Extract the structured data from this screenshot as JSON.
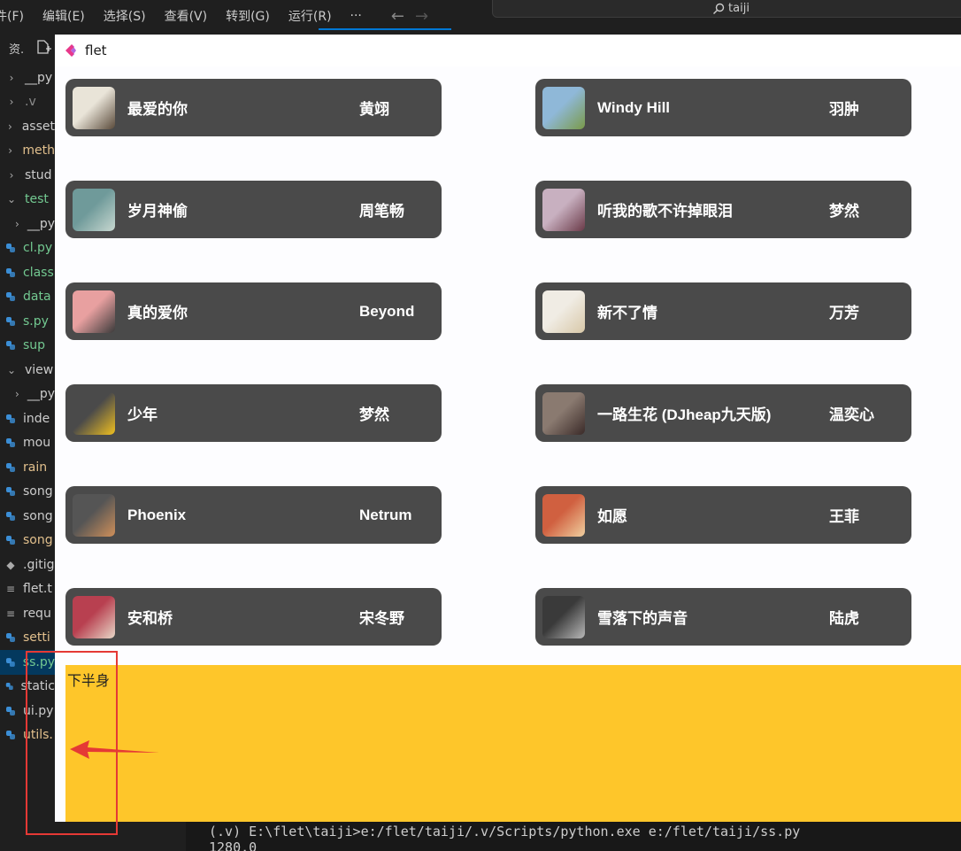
{
  "menubar": {
    "items": [
      "件(F)",
      "编辑(E)",
      "选择(S)",
      "查看(V)",
      "转到(G)",
      "运行(R)",
      "···"
    ],
    "search_text": "taiji"
  },
  "explorer": {
    "title": "资.",
    "rows": [
      {
        "label": "__py",
        "kind": "folder",
        "color": "c-gray",
        "expanded": false,
        "indent": false
      },
      {
        "label": ".v",
        "kind": "folder",
        "color": "c-dim",
        "expanded": false,
        "indent": false
      },
      {
        "label": "asset",
        "kind": "folder",
        "color": "c-gray",
        "expanded": false,
        "indent": false
      },
      {
        "label": "meth",
        "kind": "folder",
        "color": "c-yellow",
        "expanded": false,
        "indent": false
      },
      {
        "label": "stud",
        "kind": "folder",
        "color": "c-gray",
        "expanded": false,
        "indent": false
      },
      {
        "label": "test",
        "kind": "folder",
        "color": "c-green",
        "expanded": true,
        "indent": false
      },
      {
        "label": "__py",
        "kind": "folder",
        "color": "c-gray",
        "expanded": false,
        "indent": true
      },
      {
        "label": "cl.py",
        "kind": "py",
        "color": "c-green",
        "indent": false
      },
      {
        "label": "class",
        "kind": "py",
        "color": "c-green",
        "indent": false
      },
      {
        "label": "data",
        "kind": "py",
        "color": "c-green",
        "indent": false
      },
      {
        "label": "s.py",
        "kind": "py",
        "color": "c-green",
        "indent": false
      },
      {
        "label": "sup",
        "kind": "py",
        "color": "c-green",
        "indent": false
      },
      {
        "label": "view",
        "kind": "folder",
        "color": "c-gray",
        "expanded": true,
        "indent": false
      },
      {
        "label": "__py",
        "kind": "folder",
        "color": "c-gray",
        "expanded": false,
        "indent": true
      },
      {
        "label": "inde",
        "kind": "py",
        "color": "c-gray",
        "indent": false
      },
      {
        "label": "mou",
        "kind": "py",
        "color": "c-gray",
        "indent": false
      },
      {
        "label": "rain",
        "kind": "py",
        "color": "c-yellow",
        "indent": false
      },
      {
        "label": "song",
        "kind": "py",
        "color": "c-gray",
        "indent": false
      },
      {
        "label": "song",
        "kind": "py",
        "color": "c-gray",
        "indent": false
      },
      {
        "label": "song",
        "kind": "py",
        "color": "c-yellow",
        "indent": false
      },
      {
        "label": ".gitig",
        "kind": "git",
        "color": "c-gray",
        "indent": false
      },
      {
        "label": "flet.t",
        "kind": "txt",
        "color": "c-gray",
        "indent": false
      },
      {
        "label": "requ",
        "kind": "txt",
        "color": "c-gray",
        "indent": false
      },
      {
        "label": "setti",
        "kind": "py",
        "color": "c-yellow",
        "indent": false
      },
      {
        "label": "ss.py",
        "kind": "py",
        "color": "c-green",
        "indent": false,
        "selected": true
      },
      {
        "label": "static",
        "kind": "py",
        "color": "c-gray",
        "indent": false
      },
      {
        "label": "ui.py",
        "kind": "py",
        "color": "c-gray",
        "indent": false
      },
      {
        "label": "utils.",
        "kind": "py",
        "color": "c-yellow",
        "indent": false
      }
    ]
  },
  "terminal": {
    "line1": "(.v) E:\\flet\\taiji>e:/flet/taiji/.v/Scripts/python.exe e:/flet/taiji/ss.py",
    "line2": "1280.0"
  },
  "flet": {
    "title": "flet",
    "songs": [
      {
        "title": "最爱的你",
        "artist": "黄翊",
        "cover": [
          "#e9e4d8",
          "#5a4a3a"
        ]
      },
      {
        "title": "Windy Hill",
        "artist": "羽肿",
        "cover": [
          "#8fb8d8",
          "#7a9a48"
        ]
      },
      {
        "title": "岁月神偷",
        "artist": "周笔畅",
        "cover": [
          "#6f9a9a",
          "#c8d8d0"
        ]
      },
      {
        "title": "听我的歌不许掉眼泪",
        "artist": "梦然",
        "cover": [
          "#c8b0c0",
          "#6a3a48"
        ]
      },
      {
        "title": "真的爱你",
        "artist": "Beyond",
        "cover": [
          "#e8a0a0",
          "#3a3a3a"
        ]
      },
      {
        "title": "新不了情",
        "artist": "万芳",
        "cover": [
          "#f0ece4",
          "#d8c8a8"
        ]
      },
      {
        "title": "少年",
        "artist": "梦然",
        "cover": [
          "#4a4a4a",
          "#f0c020"
        ]
      },
      {
        "title": "一路生花 (DJheap九天版)",
        "artist": "温奕心",
        "cover": [
          "#8a7a70",
          "#3a2a28"
        ]
      },
      {
        "title": "Phoenix",
        "artist": "Netrum",
        "cover": [
          "#555555",
          "#d0905a"
        ]
      },
      {
        "title": "如愿",
        "artist": "王菲",
        "cover": [
          "#d06040",
          "#f0d0a0"
        ]
      },
      {
        "title": "安和桥",
        "artist": "宋冬野",
        "cover": [
          "#b84050",
          "#e8d8c8"
        ]
      },
      {
        "title": "雪落下的声音",
        "artist": "陆虎",
        "cover": [
          "#3a3a3a",
          "#b8b8b8"
        ]
      }
    ],
    "lower_label": "下半身",
    "lower_color": "#fec62a"
  },
  "colors": {
    "card": "#4a4a4a",
    "annotation": "#e53935",
    "accent": "#0078d4"
  }
}
